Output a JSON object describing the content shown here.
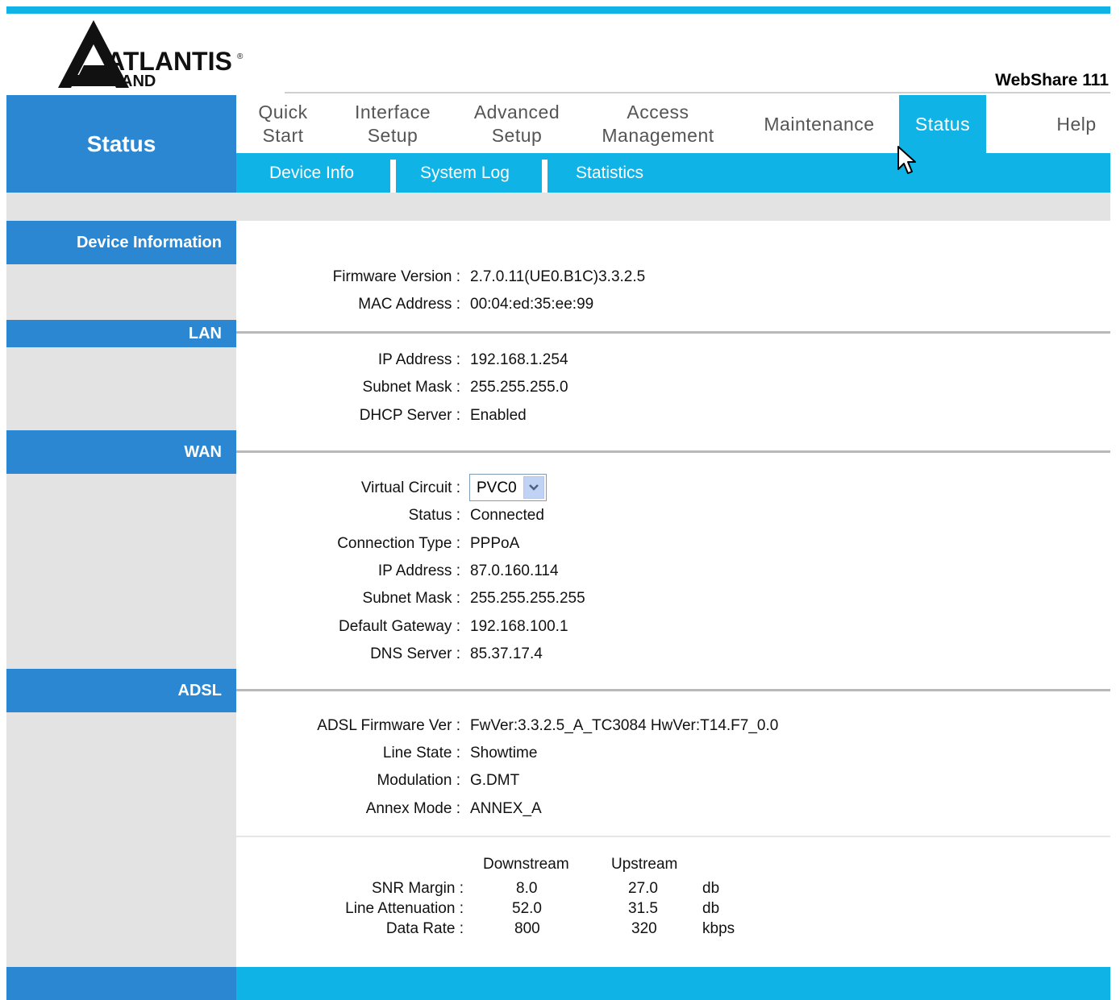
{
  "brand": {
    "logo_text": "ATLANTIS",
    "logo_sub": "AND",
    "model": "WebShare 111"
  },
  "sidebar_title": "Status",
  "nav": [
    {
      "line1": "Quick",
      "line2": "Start"
    },
    {
      "line1": "Interface",
      "line2": "Setup"
    },
    {
      "line1": "Advanced",
      "line2": "Setup"
    },
    {
      "line1": "Access",
      "line2": "Management"
    },
    {
      "line1": "Maintenance",
      "line2": ""
    },
    {
      "line1": "Status",
      "line2": ""
    },
    {
      "line1": "Help",
      "line2": ""
    }
  ],
  "subnav": [
    "Device Info",
    "System Log",
    "Statistics"
  ],
  "sections": {
    "device": "Device Information",
    "lan": "LAN",
    "wan": "WAN",
    "adsl": "ADSL"
  },
  "device": {
    "firmware_label": "Firmware Version :",
    "firmware_value": "2.7.0.11(UE0.B1C)3.3.2.5",
    "mac_label": "MAC Address :",
    "mac_value": "00:04:ed:35:ee:99"
  },
  "lan": {
    "ip_label": "IP Address :",
    "ip_value": "192.168.1.254",
    "mask_label": "Subnet Mask :",
    "mask_value": "255.255.255.0",
    "dhcp_label": "DHCP Server :",
    "dhcp_value": "Enabled"
  },
  "wan": {
    "vc_label": "Virtual Circuit :",
    "vc_value": "PVC0",
    "status_label": "Status :",
    "status_value": "Connected",
    "conn_label": "Connection Type :",
    "conn_value": "PPPoA",
    "ip_label": "IP Address :",
    "ip_value": "87.0.160.114",
    "mask_label": "Subnet Mask :",
    "mask_value": "255.255.255.255",
    "gw_label": "Default Gateway :",
    "gw_value": "192.168.100.1",
    "dns_label": "DNS Server :",
    "dns_value": "85.37.17.4"
  },
  "adsl": {
    "fw_label": "ADSL Firmware Ver :",
    "fw_value": "FwVer:3.3.2.5_A_TC3084 HwVer:T14.F7_0.0",
    "line_label": "Line State :",
    "line_value": "Showtime",
    "mod_label": "Modulation :",
    "mod_value": "G.DMT",
    "annex_label": "Annex Mode :",
    "annex_value": "ANNEX_A",
    "stats": {
      "headers": [
        "Downstream",
        "Upstream"
      ],
      "rows": [
        {
          "label": "SNR Margin :",
          "down": "8.0",
          "up": "27.0",
          "unit": "db"
        },
        {
          "label": "Line Attenuation :",
          "down": "52.0",
          "up": "31.5",
          "unit": "db"
        },
        {
          "label": "Data Rate :",
          "down": "800",
          "up": "320",
          "unit": "kbps"
        }
      ]
    }
  },
  "colors": {
    "cyan": "#0fb3e6",
    "blue": "#2c87d2",
    "grey": "#e3e3e3"
  },
  "icons": {
    "cursor": "mouse-pointer-icon",
    "select_arrow": "chevron-down-icon"
  }
}
